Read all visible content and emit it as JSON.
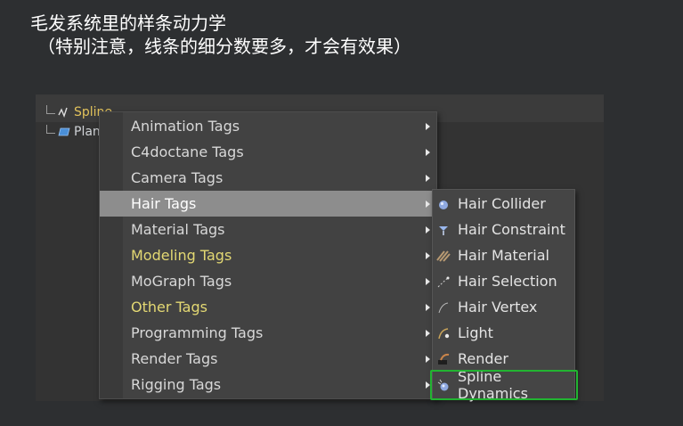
{
  "slide": {
    "title": "毛发系统里的样条动力学",
    "subtitle": "（特别注意，线条的细分数要多，才会有效果）"
  },
  "object_manager": {
    "objects": [
      {
        "label": "Spline",
        "icon": "spline-icon",
        "color": "#e2c25b"
      },
      {
        "label": "Plane",
        "icon": "plane-icon",
        "color": "#cfd2d6"
      }
    ]
  },
  "main_menu": {
    "items": [
      {
        "label": "Animation Tags",
        "has_submenu": true
      },
      {
        "label": "C4doctane Tags",
        "has_submenu": true
      },
      {
        "label": "Camera Tags",
        "has_submenu": true
      },
      {
        "label": "Hair Tags",
        "has_submenu": true,
        "state": "active"
      },
      {
        "label": "Material Tags",
        "has_submenu": true
      },
      {
        "label": "Modeling Tags",
        "has_submenu": true,
        "color": "#e3d873"
      },
      {
        "label": "MoGraph Tags",
        "has_submenu": true
      },
      {
        "label": "Other Tags",
        "has_submenu": true,
        "color": "#e3d873"
      },
      {
        "label": "Programming Tags",
        "has_submenu": true
      },
      {
        "label": "Render Tags",
        "has_submenu": true
      },
      {
        "label": "Rigging Tags",
        "has_submenu": true
      }
    ]
  },
  "hair_submenu": {
    "items": [
      {
        "label": "Hair Collider",
        "icon": "hair-collider-icon"
      },
      {
        "label": "Hair Constraint",
        "icon": "hair-constraint-icon"
      },
      {
        "label": "Hair Material",
        "icon": "hair-material-icon"
      },
      {
        "label": "Hair Selection",
        "icon": "hair-selection-icon"
      },
      {
        "label": "Hair Vertex",
        "icon": "hair-vertex-icon"
      },
      {
        "label": "Light",
        "icon": "hair-light-icon"
      },
      {
        "label": "Render",
        "icon": "hair-render-icon"
      },
      {
        "label": "Spline Dynamics",
        "icon": "spline-dynamics-icon",
        "highlighted": true
      }
    ]
  },
  "colors": {
    "highlight_border": "#22b431",
    "menu_active_bg": "#8d8d8d",
    "menu_bg": "#424242",
    "yellow_text": "#e3d873"
  }
}
